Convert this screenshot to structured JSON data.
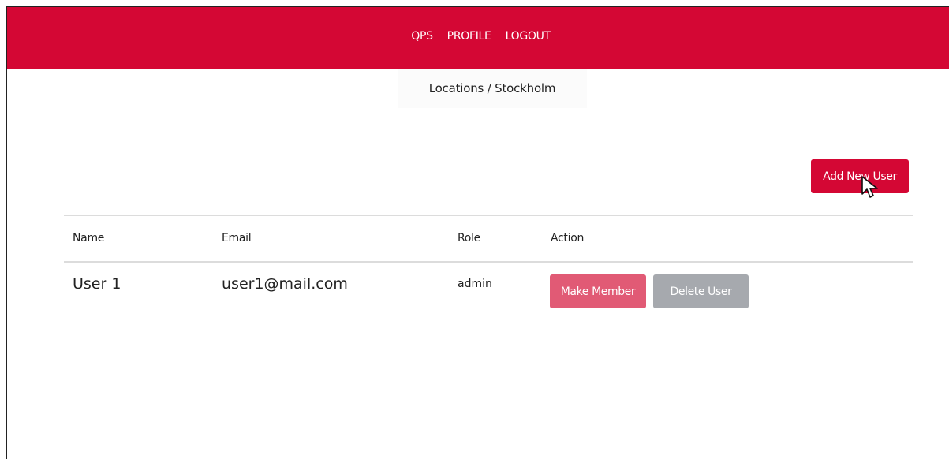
{
  "nav": {
    "items": [
      {
        "label": "QPS"
      },
      {
        "label": "PROFILE"
      },
      {
        "label": "LOGOUT"
      }
    ]
  },
  "breadcrumb": {
    "text": "Locations / Stockholm"
  },
  "actions": {
    "add_user_label": "Add New User"
  },
  "table": {
    "headers": {
      "name": "Name",
      "email": "Email",
      "role": "Role",
      "action": "Action"
    },
    "rows": [
      {
        "name": "User 1",
        "email": "user1@mail.com",
        "role": "admin",
        "make_member_label": "Make Member",
        "delete_label": "Delete User"
      }
    ]
  },
  "colors": {
    "brand": "#d40734",
    "make_member": "#e15a75",
    "delete": "#a6a9ae"
  },
  "icons": {
    "cursor": "mouse-pointer-icon"
  }
}
